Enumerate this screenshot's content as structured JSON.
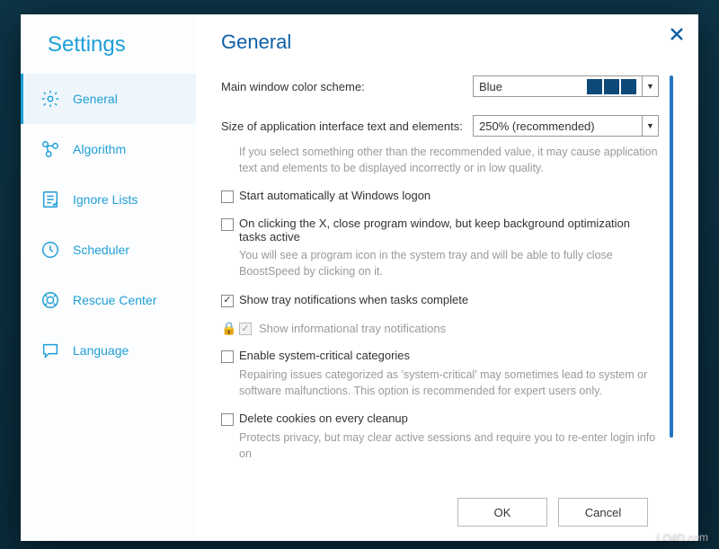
{
  "sidebar": {
    "title": "Settings",
    "items": [
      {
        "label": "General"
      },
      {
        "label": "Algorithm"
      },
      {
        "label": "Ignore Lists"
      },
      {
        "label": "Scheduler"
      },
      {
        "label": "Rescue Center"
      },
      {
        "label": "Language"
      }
    ]
  },
  "page": {
    "title": "General",
    "color_scheme_label": "Main window color scheme:",
    "color_scheme_value": "Blue",
    "text_size_label": "Size of application interface text and elements:",
    "text_size_value": "250% (recommended)",
    "text_size_hint": "If you select something other than the recommended value, it may cause application text and elements to be displayed incorrectly or in low quality.",
    "cb_autostart": "Start automatically at Windows logon",
    "cb_close_x": "On clicking the X, close program window, but keep background optimization tasks active",
    "cb_close_x_hint": "You will see a program icon in the system tray and will be able to fully close BoostSpeed by clicking on it.",
    "cb_tray_complete": "Show tray notifications when tasks complete",
    "cb_tray_info": "Show informational tray notifications",
    "cb_syscrit": "Enable system-critical categories",
    "cb_syscrit_hint": "Repairing issues categorized as 'system-critical' may sometimes lead to system or software malfunctions. This option is recommended for expert users only.",
    "cb_cookies": "Delete cookies on every cleanup",
    "cb_cookies_hint": "Protects privacy, but may clear active sessions and require you to re-enter login info on"
  },
  "footer": {
    "ok": "OK",
    "cancel": "Cancel"
  },
  "watermark": "LO4D.com"
}
